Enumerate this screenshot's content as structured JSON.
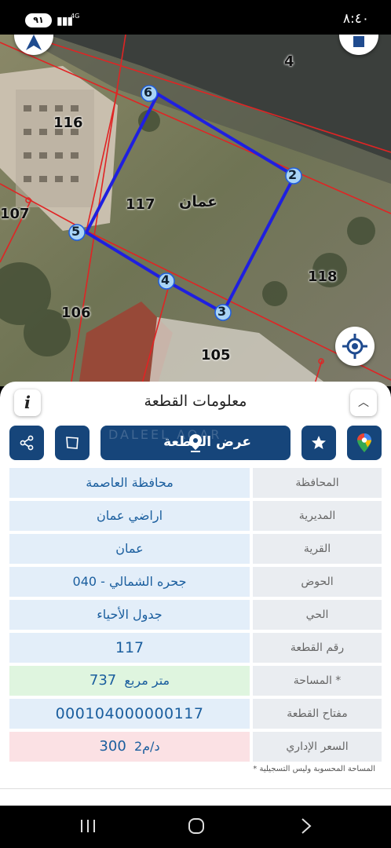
{
  "status_bar": {
    "time": "٨:٤٠",
    "battery": "٩١",
    "network": "4G"
  },
  "map": {
    "parcels": [
      {
        "label": "116"
      },
      {
        "label": "117"
      },
      {
        "label": "118"
      },
      {
        "label": "107"
      },
      {
        "label": "106"
      },
      {
        "label": "105"
      },
      {
        "label": "4"
      }
    ],
    "area_label": "عمان",
    "vertices": [
      "6",
      "2",
      "3",
      "4",
      "5"
    ],
    "colors": {
      "boundary": "#1f1fe0",
      "parcel_lines": "#e02424"
    }
  },
  "panel": {
    "title": "معلومات القطعة",
    "info_icon": "i",
    "show_plot_label": "عرض القطعة",
    "watermark": "DALEEL AQAR",
    "rows": [
      {
        "key": "المحافظة",
        "value": "محافظة العاصمة"
      },
      {
        "key": "المديرية",
        "value": "اراضي عمان"
      },
      {
        "key": "القرية",
        "value": "عمان"
      },
      {
        "key": "الحوض",
        "value": "جحره الشمالي - 040"
      },
      {
        "key": "الحي",
        "value": "جدول الأحياء"
      },
      {
        "key": "رقم القطعة",
        "value": "117"
      },
      {
        "key": "المساحة *",
        "value_number": "737",
        "value_unit": "متر مربع"
      },
      {
        "key": "مفتاح القطعة",
        "value": "000104000000117"
      },
      {
        "key": "السعر الإداري",
        "value_number": "300",
        "value_unit": "د/م2"
      }
    ],
    "note": "* المساحة المحسوبة وليس التسجيلية",
    "colors": {
      "primary": "#16457a",
      "value_text": "#1a5e9e",
      "area_bg": "#dff5df",
      "price_bg": "#fbe1e4"
    }
  }
}
